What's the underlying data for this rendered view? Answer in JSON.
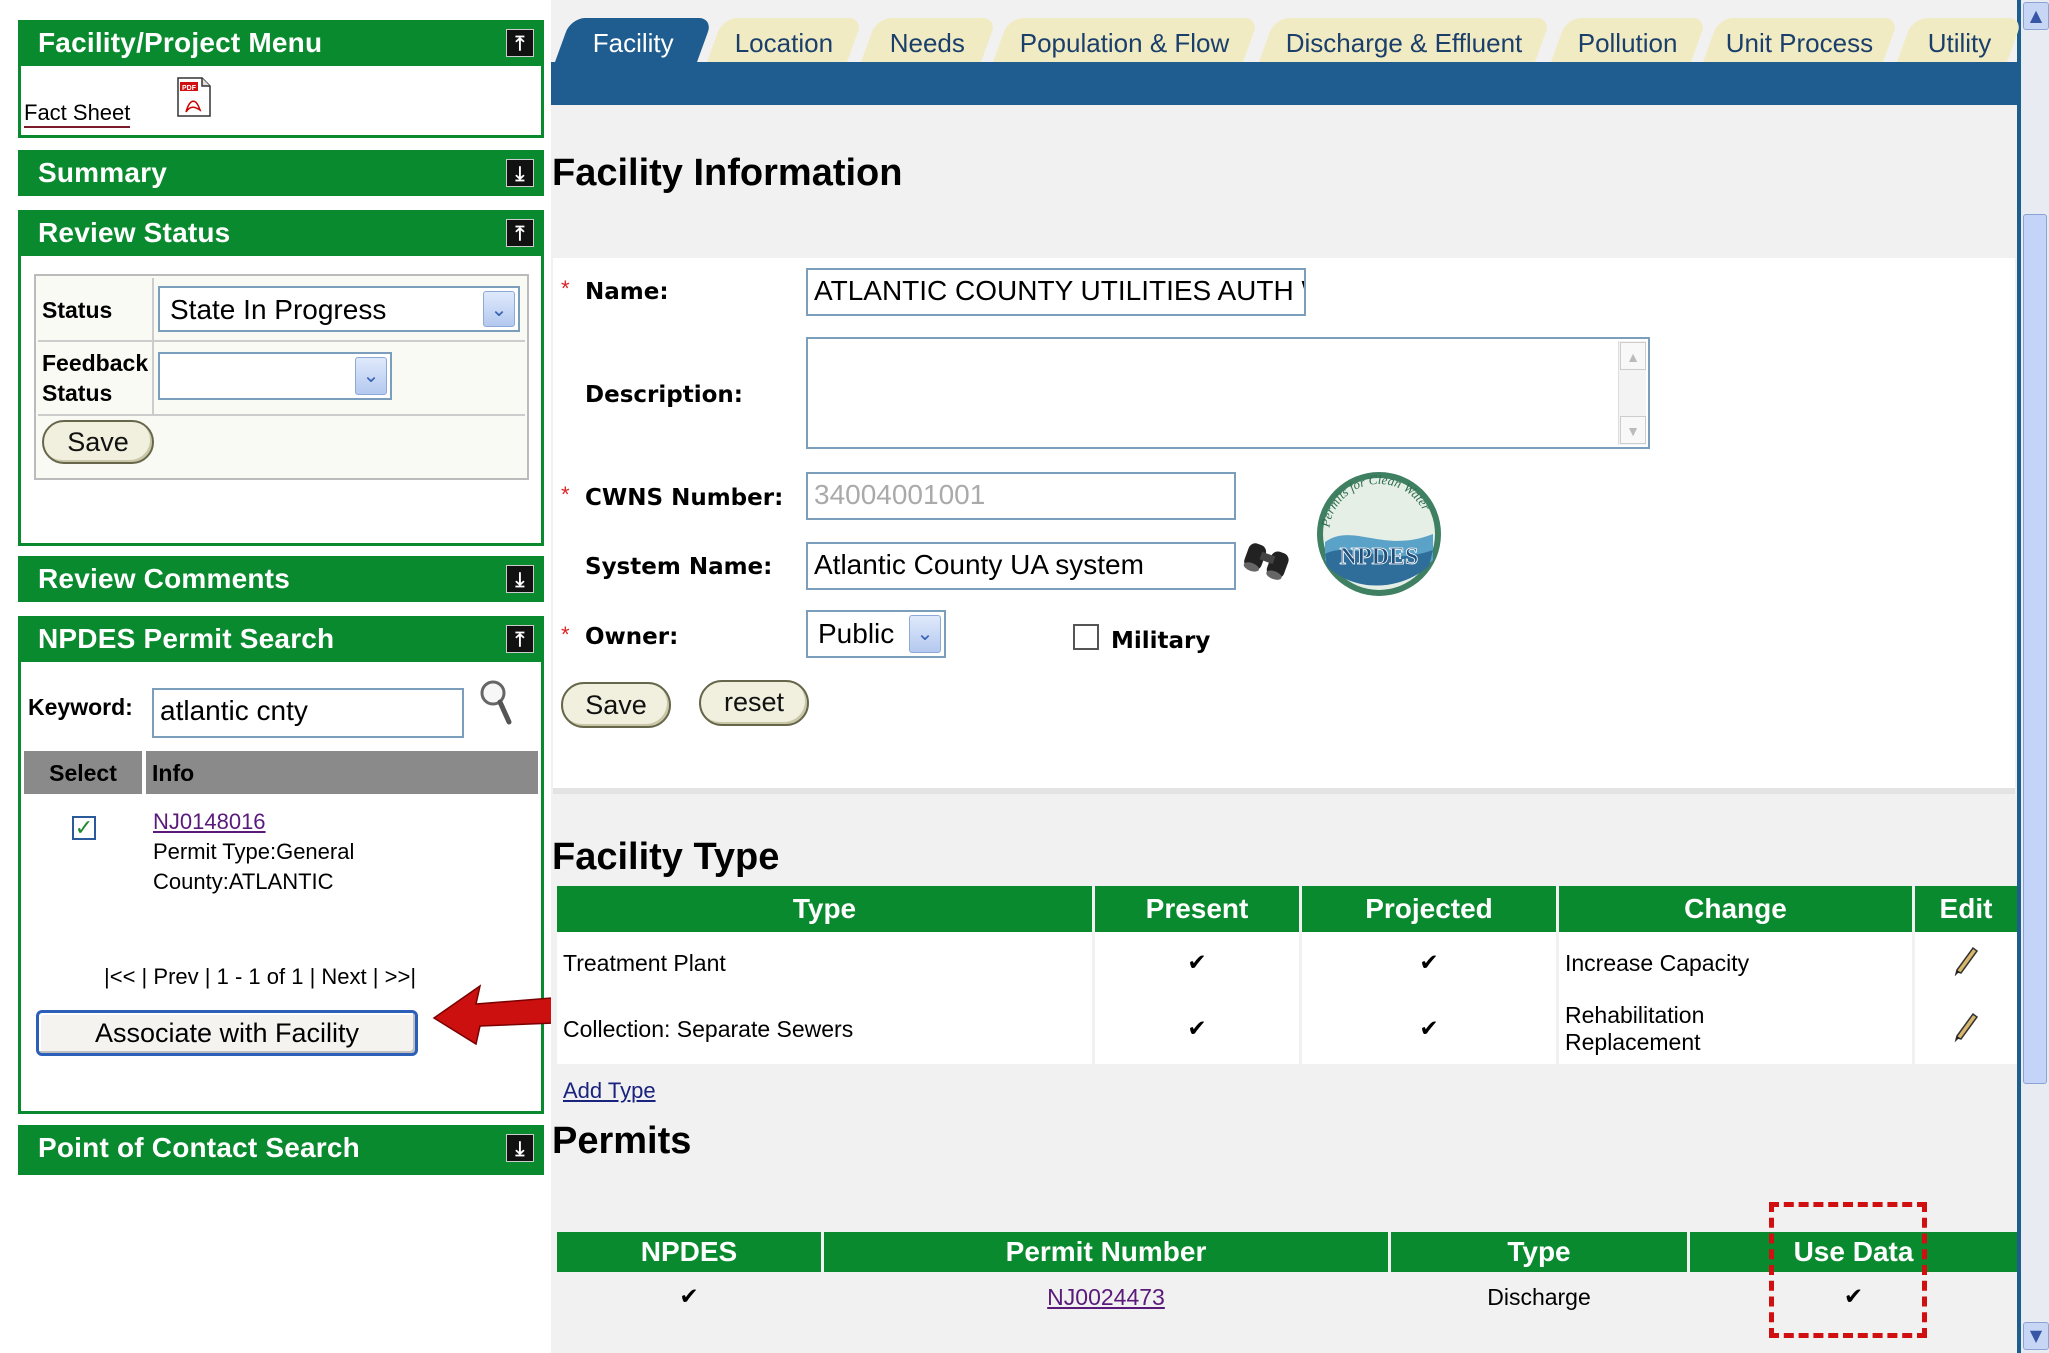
{
  "sidebar": {
    "facility_menu": {
      "title": "Facility/Project Menu",
      "toggle": "⤒",
      "fact_sheet": "Fact Sheet",
      "pdf_label": "PDF"
    },
    "summary": {
      "title": "Summary",
      "toggle": "⤓"
    },
    "review_status": {
      "title": "Review Status",
      "toggle": "⤒",
      "status_label": "Status",
      "status_value": "State In Progress",
      "feedback_label_1": "Feedback",
      "feedback_label_2": "Status",
      "feedback_value": "",
      "save_label": "Save"
    },
    "review_comments": {
      "title": "Review Comments",
      "toggle": "⤓"
    },
    "permit_search": {
      "title": "NPDES Permit Search",
      "toggle": "⤒",
      "keyword_label": "Keyword:",
      "keyword_value": "atlantic cnty",
      "col_select": "Select",
      "col_info": "Info",
      "result": {
        "permit": "NJ0148016",
        "type": "Permit Type:General",
        "county": "County:ATLANTIC",
        "checked": true
      },
      "pagination": {
        "first": "|<<",
        "prev": "Prev",
        "range": "1 - 1 of 1",
        "next": "Next",
        "last": ">>|"
      },
      "associate_label": "Associate with Facility"
    },
    "contact_search": {
      "title": "Point of Contact Search",
      "toggle": "⤓"
    }
  },
  "tabs": [
    "Facility",
    "Location",
    "Needs",
    "Population & Flow",
    "Discharge & Effluent",
    "Pollution",
    "Unit Process",
    "Utility"
  ],
  "facility_info": {
    "heading": "Facility Information",
    "name_label": "Name:",
    "name_value": "ATLANTIC COUNTY UTILITIES AUTH WWTF",
    "description_label": "Description:",
    "description_value": "",
    "cwns_label": "CWNS Number:",
    "cwns_value": "34004001001",
    "system_label": "System Name:",
    "system_value": "Atlantic County UA system",
    "owner_label": "Owner:",
    "owner_value": "Public",
    "military_label": "Military",
    "save_label": "Save",
    "reset_label": "reset",
    "logo": {
      "text": "NPDES",
      "arc_text": "Permits for Clean Water"
    }
  },
  "facility_type": {
    "heading": "Facility Type",
    "columns": [
      "Type",
      "Present",
      "Projected",
      "Change",
      "Edit"
    ],
    "rows": [
      {
        "type": "Treatment Plant",
        "present": "✔",
        "projected": "✔",
        "change_1": "Increase Capacity",
        "change_2": ""
      },
      {
        "type": "Collection: Separate Sewers",
        "present": "✔",
        "projected": "✔",
        "change_1": "Rehabilitation",
        "change_2": "Replacement"
      }
    ],
    "add_type": "Add Type"
  },
  "permits": {
    "heading": "Permits",
    "columns": [
      "NPDES",
      "Permit Number",
      "Type",
      "Use Data"
    ],
    "rows": [
      {
        "npdes": "✔",
        "permit_number": "NJ0024473",
        "type": "Discharge",
        "use_data": "✔"
      }
    ]
  },
  "colors": {
    "accent_green": "#0a8a2e",
    "tab_blue": "#1f5c8f",
    "arrow_red": "#cc1010",
    "highlight_red": "#d01010"
  },
  "icons": {
    "edit": "pencil-icon",
    "search": "magnifier-icon",
    "lookup": "binoculars-icon"
  }
}
